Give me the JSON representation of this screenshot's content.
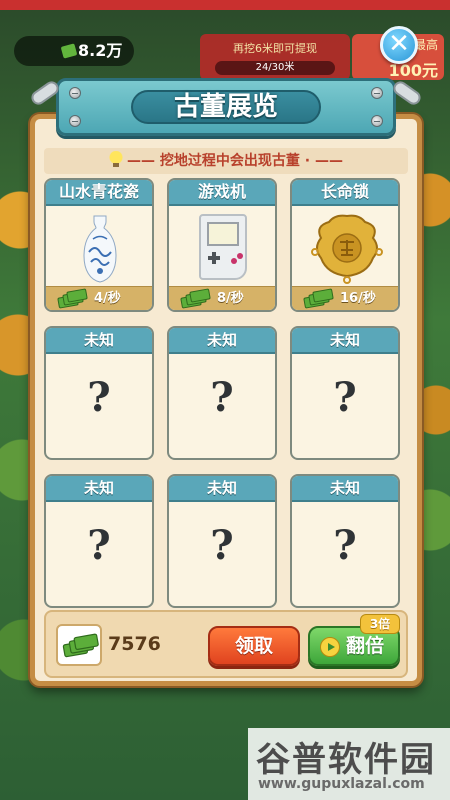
{
  "background": {
    "money": "8.2万",
    "task_text": "再挖6米即可提现",
    "task_progress": "24/30米",
    "goal_label": "最高",
    "goal_amount": "100元"
  },
  "panel": {
    "title": "古董展览",
    "subtitle": "—— 挖地过程中会出现古董 · ——"
  },
  "items": [
    {
      "name": "山水青花瓷",
      "rate": "4/秒",
      "icon": "porcelain-vase-icon",
      "known": true
    },
    {
      "name": "游戏机",
      "rate": "8/秒",
      "icon": "game-console-icon",
      "known": true
    },
    {
      "name": "长命锁",
      "rate": "16/秒",
      "icon": "longevity-lock-icon",
      "known": true
    },
    {
      "name": "未知",
      "mark": "?",
      "known": false
    },
    {
      "name": "未知",
      "mark": "?",
      "known": false
    },
    {
      "name": "未知",
      "mark": "?",
      "known": false
    },
    {
      "name": "未知",
      "mark": "?",
      "known": false
    },
    {
      "name": "未知",
      "mark": "?",
      "known": false
    },
    {
      "name": "未知",
      "mark": "?",
      "known": false
    }
  ],
  "footer": {
    "total": "7576",
    "claim_label": "领取",
    "double_label": "翻倍",
    "double_badge": "3倍"
  },
  "watermark": {
    "brand": "谷普软件园",
    "url": "www.gupuxlazal.com"
  },
  "colors": {
    "panel_bg": "#f7ead2",
    "card_cap": "#5aa7b9",
    "claim_button": "#e0431f",
    "double_button": "#3da63a"
  }
}
